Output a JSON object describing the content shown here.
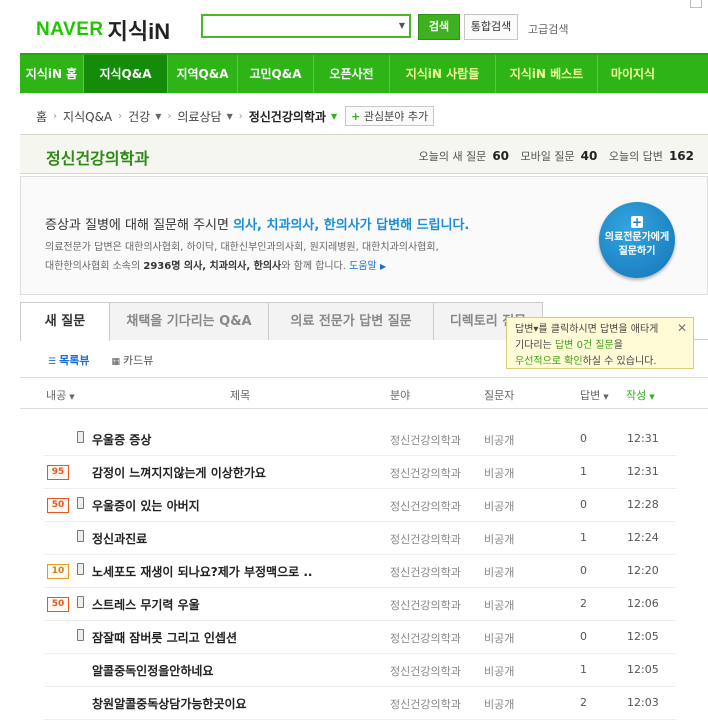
{
  "header": {
    "logo_brand": "NAVER",
    "logo_service": "지식iN",
    "search_button": "검색",
    "unified_button": "통합검색",
    "advanced_link": "고급검색"
  },
  "nav": {
    "tabs": [
      {
        "label": "지식iN 홈",
        "w": 64
      },
      {
        "label": "지식Q&A",
        "w": 84
      },
      {
        "label": "지역Q&A",
        "w": 70
      },
      {
        "label": "고민Q&A",
        "w": 76
      },
      {
        "label": "오픈사전",
        "w": 76
      },
      {
        "label": "지식iN 사람들",
        "w": 106
      },
      {
        "label": "지식iN 베스트",
        "w": 102
      },
      {
        "label": "마이지식",
        "w": 70
      }
    ]
  },
  "breadcrumb": {
    "items": [
      "홈",
      "지식Q&A",
      "건강",
      "의료상담"
    ],
    "current": "정신건강의학과",
    "interest_button": "관심분야 추가"
  },
  "title_bar": {
    "title": "정신건강의학과",
    "stat1_label": "오늘의 새 질문",
    "stat1_value": "60",
    "stat2_label": "모바일 질문",
    "stat2_value": "40",
    "stat3_label": "오늘의 답변",
    "stat3_value": "162"
  },
  "promo": {
    "headline_pre": "증상과 질병에 대해 질문해 주시면 ",
    "headline_hl": "의사, 치과의사, 한의사가 답변해 드립니다.",
    "line1": "의료전문가 답변은 대한의사협회, 하이닥, 대한신부인과의사회, 원지레병원, 대한치과의사협회,",
    "line2_pre": "대한한의사협회 소속의 ",
    "line2_bold": "2936명 의사, 치과의사, 한의사",
    "line2_post": "와 함께 합니다. ",
    "help_link": "도움말",
    "ask_line1": "의료전문가에게",
    "ask_line2": "질문하기"
  },
  "tabs": [
    {
      "label": "새 질문",
      "active": true
    },
    {
      "label": "채택을 기다리는 Q&A",
      "active": false
    },
    {
      "label": "의료 전문가 답변 질문",
      "active": false
    },
    {
      "label": "디렉토리 전문",
      "active": false
    }
  ],
  "tooltip": {
    "line1": "답변▾를 클릭하시면 답변을 애타게",
    "line2_pre": "기다리는 ",
    "line2_hl": "답변 0건 질문",
    "line2_post": "을",
    "line3_hl": "우선적으로 확인",
    "line3_post": "하실 수 있습니다."
  },
  "view_switch": {
    "list": "목록뷰",
    "card": "카드뷰"
  },
  "table": {
    "headers": {
      "bet": "내공",
      "title": "제목",
      "category": "분야",
      "asker": "질문자",
      "answers": "답변",
      "created": "작성"
    },
    "rows": [
      {
        "badge": "",
        "mobile": true,
        "title": "우울증 증상",
        "category": "정신건강의학과",
        "asker": "비공개",
        "answers": "0",
        "time": "12:31"
      },
      {
        "badge": "95",
        "mobile": false,
        "title": "감정이 느껴지지않는게 이상한가요",
        "category": "정신건강의학과",
        "asker": "비공개",
        "answers": "1",
        "time": "12:31"
      },
      {
        "badge": "50",
        "mobile": true,
        "title": "우울증이 있는 아버지",
        "category": "정신건강의학과",
        "asker": "비공개",
        "answers": "0",
        "time": "12:28"
      },
      {
        "badge": "",
        "mobile": true,
        "title": "정신과진료",
        "category": "정신건강의학과",
        "asker": "비공개",
        "answers": "1",
        "time": "12:24"
      },
      {
        "badge": "10",
        "mobile": true,
        "title": "노세포도 재생이 되나요?제가 부정맥으로 ..",
        "category": "정신건강의학과",
        "asker": "비공개",
        "answers": "0",
        "time": "12:20"
      },
      {
        "badge": "50",
        "mobile": true,
        "title": "스트레스 무기력 우울",
        "category": "정신건강의학과",
        "asker": "비공개",
        "answers": "2",
        "time": "12:06"
      },
      {
        "badge": "",
        "mobile": true,
        "title": "잠잘때 잠버릇 그리고 인셉션",
        "category": "정신건강의학과",
        "asker": "비공개",
        "answers": "0",
        "time": "12:05"
      },
      {
        "badge": "",
        "mobile": false,
        "title": "알콜중독인정을안하네요",
        "category": "정신건강의학과",
        "asker": "비공개",
        "answers": "1",
        "time": "12:05"
      },
      {
        "badge": "",
        "mobile": false,
        "title": "창원알콜중독상담가능한곳이요",
        "category": "정신건강의학과",
        "asker": "비공개",
        "answers": "2",
        "time": "12:03"
      }
    ]
  }
}
